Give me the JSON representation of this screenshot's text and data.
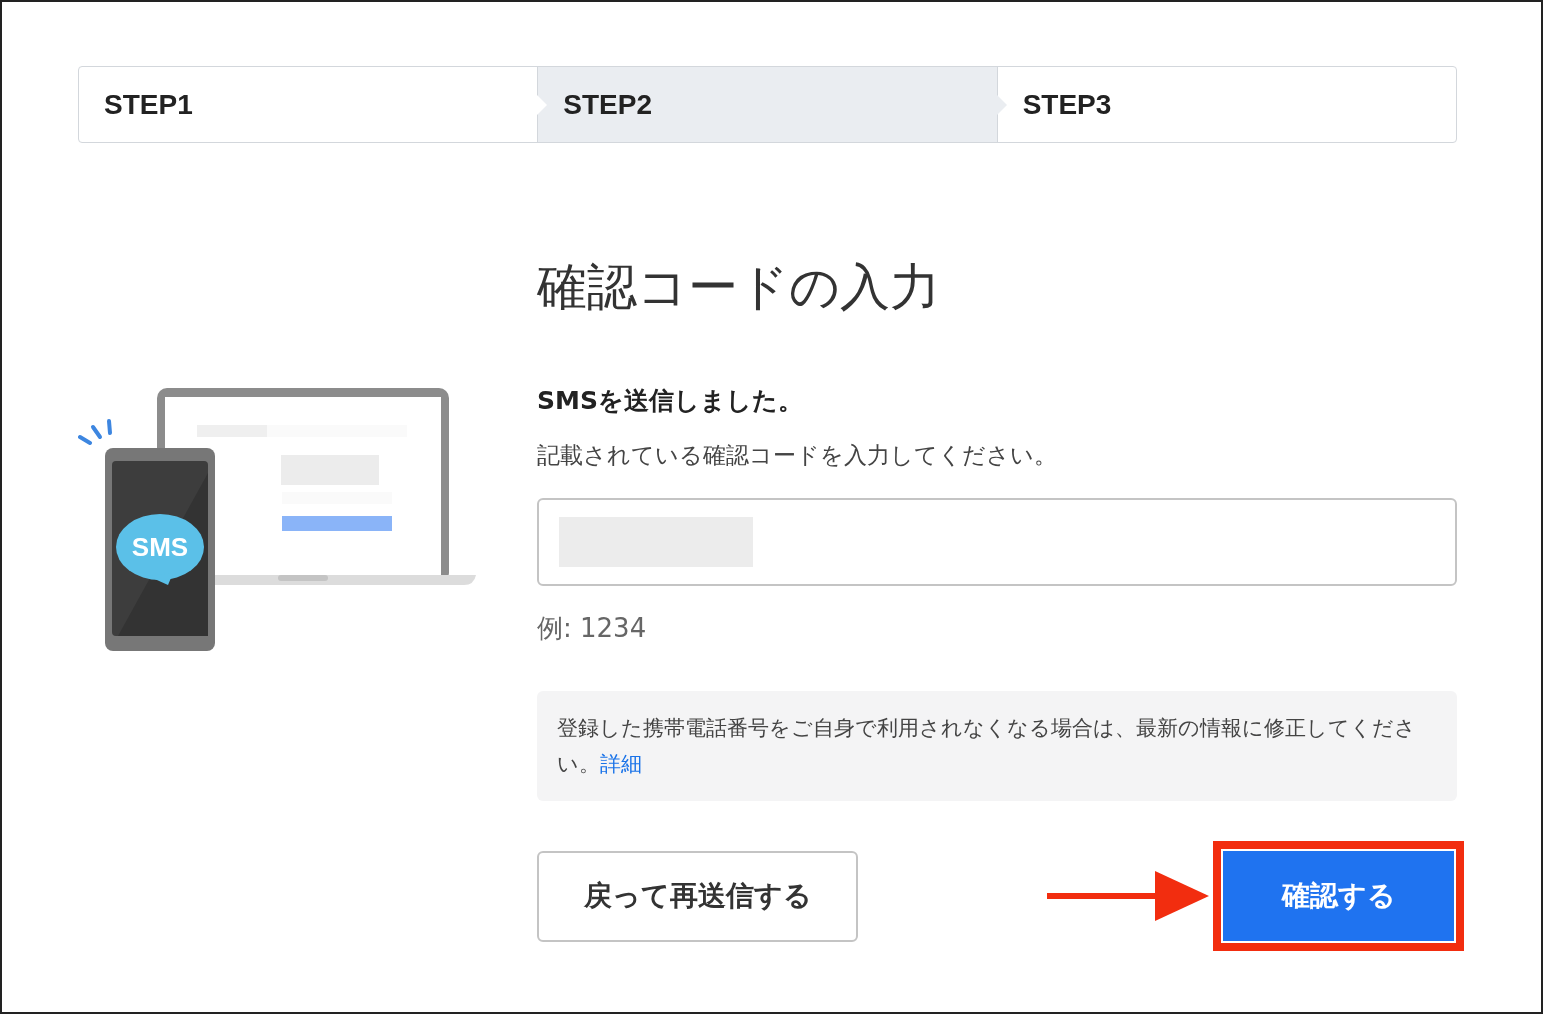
{
  "steps": [
    {
      "label": "STEP1",
      "selected": false
    },
    {
      "label": "STEP2",
      "selected": true
    },
    {
      "label": "STEP3",
      "selected": false
    }
  ],
  "title": "確認コードの入力",
  "illustration": {
    "bubble_label": "SMS"
  },
  "message": {
    "heading": "SMSを送信しました。",
    "description": "記載されている確認コードを入力してください。"
  },
  "code_field": {
    "value_redacted": true,
    "hint": "例: 1234"
  },
  "notice": {
    "text": "登録した携帯電話番号をご自身で利用されなくなる場合は、最新の情報に修正してください。",
    "link": "詳細"
  },
  "buttons": [
    {
      "kind": "secondary",
      "label": "戻って再送信する",
      "highlighted": false
    },
    {
      "kind": "primary",
      "label": "確認する",
      "highlighted": true
    }
  ]
}
